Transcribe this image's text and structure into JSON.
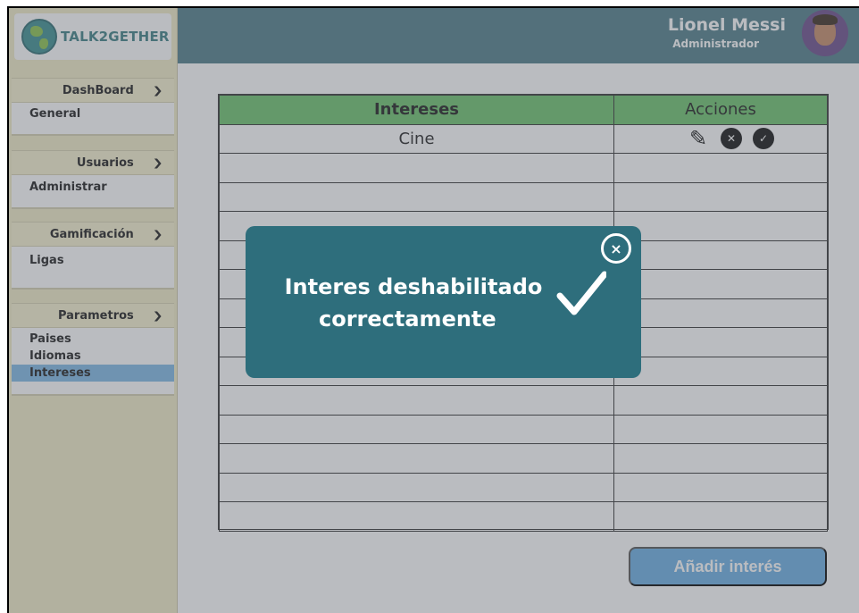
{
  "app": {
    "logo_text": "TALK2GETHER"
  },
  "user": {
    "name": "Lionel Messi",
    "role": "Administrador"
  },
  "sidebar": {
    "sections": [
      {
        "title": "DashBoard",
        "items": [
          "General"
        ]
      },
      {
        "title": "Usuarios",
        "items": [
          "Administrar"
        ]
      },
      {
        "title": "Gamificación",
        "items": [
          "Ligas"
        ]
      },
      {
        "title": "Parametros",
        "items": [
          "Paises",
          "Idiomas",
          "Intereses"
        ]
      }
    ],
    "active_item": "Intereses"
  },
  "table": {
    "headers": {
      "interests": "Intereses",
      "actions": "Acciones"
    },
    "rows": [
      {
        "interest": "Cine",
        "has_actions": true
      }
    ],
    "empty_rows": 13
  },
  "add_button": {
    "label": "Añadir interés"
  },
  "modal": {
    "line1": "Interes deshabilitado",
    "line2": "correctamente",
    "close_symbol": "×"
  },
  "colors": {
    "header_bg": "#4f7d89",
    "sidebar_bg": "#f2ecc6",
    "table_header_bg": "#6cc36b",
    "active_item": "#7fb9e6",
    "button_bg": "#6aaee3",
    "modal_bg": "#2e6e7c"
  },
  "icons": {
    "edit": "pencil-icon",
    "disable": "x-circle-icon",
    "enable": "check-circle-icon",
    "modal_close": "close-circle-icon",
    "modal_success": "checkmark-icon"
  }
}
